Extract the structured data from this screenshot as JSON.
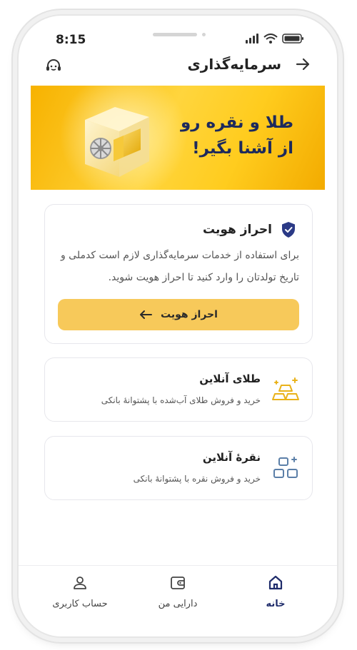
{
  "status_bar": {
    "time": "8:15"
  },
  "header": {
    "title": "سرمایه‌گذاری",
    "back_icon": "arrow-right-icon",
    "support_icon": "headset-icon"
  },
  "banner": {
    "line1": "طلا و نقره رو",
    "line2": "از آشنا بگیر!"
  },
  "kyc": {
    "title": "احراز هویت",
    "description": "برای استفاده از خدمات سرمایه‌گذاری لازم است کدملی و تاریخ تولدتان را وارد کنید تا احراز هویت شوید.",
    "button_label": "احراز هویت"
  },
  "products": [
    {
      "title": "طلای آنلاین",
      "subtitle": "خرید و فروش طلای آب‌شده با پشتوانهٔ بانکی",
      "icon": "gold-bars-icon"
    },
    {
      "title": "نقرهٔ آنلاین",
      "subtitle": "خرید و فروش نقره با پشتوانهٔ بانکی",
      "icon": "silver-bars-icon"
    }
  ],
  "tabs": [
    {
      "label": "خانه",
      "icon": "home-icon",
      "active": true
    },
    {
      "label": "دارایی من",
      "icon": "wallet-icon",
      "active": false
    },
    {
      "label": "حساب کاربری",
      "icon": "user-icon",
      "active": false
    }
  ],
  "colors": {
    "accent": "#f7c95a",
    "navy": "#1f2c6b",
    "banner": "#ffcc1e",
    "gold_icon": "#e9b21a",
    "silver_icon": "#5b7fa8"
  }
}
